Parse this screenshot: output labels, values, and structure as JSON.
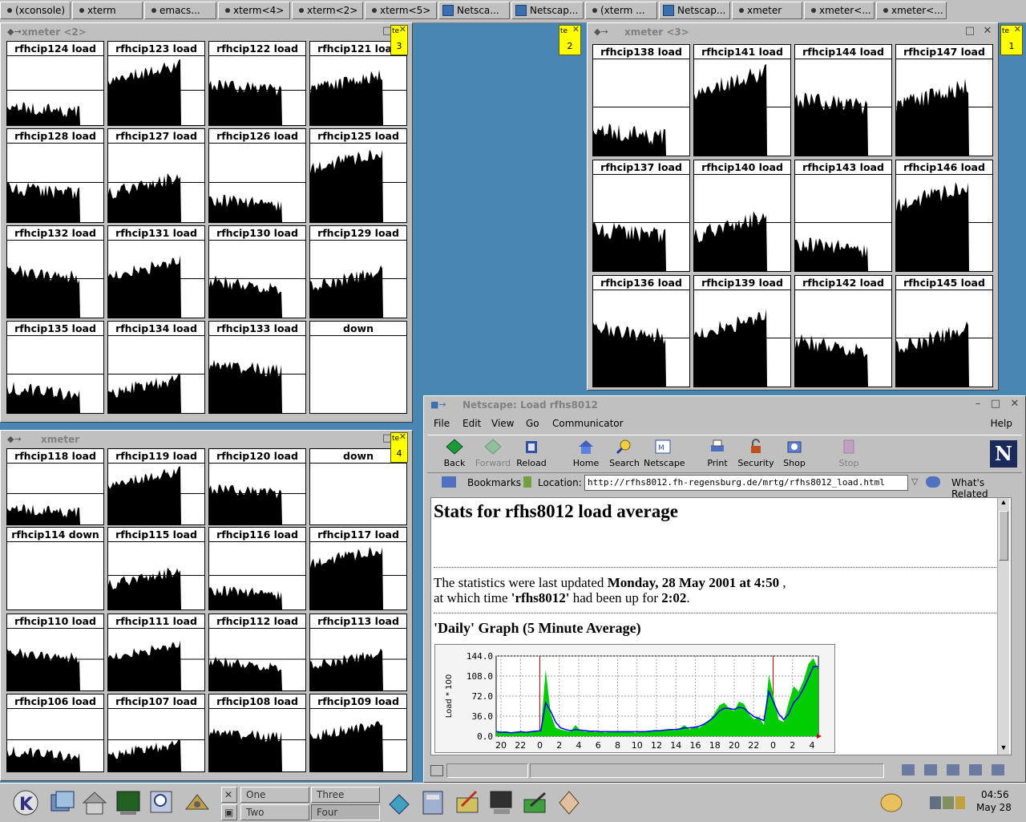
{
  "taskbar": [
    {
      "label": "(xconsole)",
      "icon": "dot-icon"
    },
    {
      "label": "xterm",
      "icon": "dot-icon"
    },
    {
      "label": "emacs...",
      "icon": "dot-icon"
    },
    {
      "label": "xterm<4>",
      "icon": "dot-icon"
    },
    {
      "label": "xterm<2>",
      "icon": "dot-icon"
    },
    {
      "label": "xterm<5>",
      "icon": "dot-icon"
    },
    {
      "label": "Netsca...",
      "icon": "netscape-icon"
    },
    {
      "label": "Netscap...",
      "icon": "netscape-icon"
    },
    {
      "label": "(xterm ...",
      "icon": "dot-icon"
    },
    {
      "label": "Netscap...",
      "icon": "netscape-icon"
    },
    {
      "label": "xmeter",
      "icon": "dot-icon"
    },
    {
      "label": "xmeter<...",
      "icon": "dot-icon"
    },
    {
      "label": "xmeter<...",
      "icon": "dot-icon"
    }
  ],
  "xmeter2": {
    "title": "xmeter <2>",
    "badge": "3",
    "cells": [
      "rfhcip124 load",
      "rfhcip123 load",
      "rfhcip122 load",
      "rfhcip121 load",
      "rfhcip128 load",
      "rfhcip127 load",
      "rfhcip126 load",
      "rfhcip125 load",
      "rfhcip132 load",
      "rfhcip131 load",
      "rfhcip130 load",
      "rfhcip129 load",
      "rfhcip135 load",
      "rfhcip134 load",
      "rfhcip133 load",
      "down"
    ]
  },
  "xmeter3": {
    "title": "xmeter <3>",
    "badge_left": "2",
    "badge_right": "1",
    "cells": [
      "rfhcip138 load",
      "rfhcip141 load",
      "rfhcip144 load",
      "rfhcip147 load",
      "rfhcip137 load",
      "rfhcip140 load",
      "rfhcip143 load",
      "rfhcip146 load",
      "rfhcip136 load",
      "rfhcip139 load",
      "rfhcip142 load",
      "rfhcip145 load"
    ]
  },
  "xmeter1": {
    "title": "xmeter",
    "badge": "4",
    "cells": [
      "rfhcip118 load",
      "rfhcip119 load",
      "rfhcip120 load",
      "down",
      "rfhcip114 down",
      "rfhcip115 load",
      "rfhcip116 load",
      "rfhcip117 load",
      "rfhcip110 load",
      "rfhcip111 load",
      "rfhcip112 load",
      "rfhcip113 load",
      "rfhcip106 load",
      "rfhcip107 load",
      "rfhcip108 load",
      "rfhcip109 load"
    ]
  },
  "badge_label": "te",
  "netscape": {
    "title": "Netscape: Load rfhs8012",
    "menu": [
      "File",
      "Edit",
      "View",
      "Go",
      "Communicator"
    ],
    "help": "Help",
    "toolbar": [
      "Back",
      "Forward",
      "Reload",
      "Home",
      "Search",
      "Netscape",
      "Print",
      "Security",
      "Shop",
      "Stop"
    ],
    "bookmarks": "Bookmarks",
    "location_label": "Location:",
    "url": "http://rfhs8012.fh-regensburg.de/mrtg/rfhs8012_load.html",
    "whats_related": "What's Related",
    "page": {
      "heading": "Stats for rfhs8012 load average",
      "updated_pre": "The statistics were last updated ",
      "updated_date": "Monday, 28 May 2001 at 4:50",
      "updated_post": " ,",
      "uptime_pre": "at which time ",
      "host": "'rfhs8012'",
      "uptime_mid": " had been up for ",
      "uptime": "2:02",
      "uptime_post": ".",
      "graph_heading": "'Daily' Graph (5 Minute Average)"
    }
  },
  "chart_data": {
    "type": "area",
    "ylabel": "Load * 100",
    "yticks": [
      "144.0",
      "108.0",
      "72.0",
      "36.0",
      "0.0"
    ],
    "ylim": [
      0,
      144
    ],
    "xticks": [
      "20",
      "22",
      "0",
      "2",
      "4",
      "6",
      "8",
      "10",
      "12",
      "14",
      "16",
      "18",
      "20",
      "22",
      "0",
      "2",
      "4"
    ],
    "series": [
      {
        "values": [
          10,
          8,
          9,
          7,
          8,
          9,
          6,
          8,
          10,
          9,
          120,
          40,
          15,
          12,
          10,
          8,
          20,
          10,
          8,
          9,
          7,
          8,
          6,
          8,
          9,
          7,
          8,
          9,
          6,
          8,
          9,
          8,
          10,
          9,
          11,
          12,
          10,
          14,
          20,
          12,
          18,
          15,
          22,
          28,
          40,
          55,
          60,
          50,
          45,
          62,
          58,
          40,
          30,
          35,
          20,
          110,
          70,
          30,
          25,
          60,
          90,
          80,
          100,
          130,
          140,
          120
        ]
      },
      {
        "values": [
          8,
          7,
          7,
          6,
          7,
          8,
          7,
          8,
          9,
          10,
          60,
          45,
          25,
          15,
          12,
          10,
          12,
          11,
          10,
          9,
          9,
          8,
          8,
          8,
          8,
          8,
          8,
          8,
          8,
          8,
          8,
          9,
          10,
          10,
          11,
          12,
          12,
          13,
          15,
          15,
          16,
          18,
          22,
          28,
          35,
          45,
          50,
          50,
          48,
          52,
          50,
          42,
          35,
          32,
          28,
          80,
          60,
          40,
          30,
          40,
          60,
          70,
          85,
          105,
          125,
          125
        ]
      }
    ]
  },
  "desktops": [
    "One",
    "Two",
    "Three",
    "Four"
  ],
  "clock": {
    "time": "04:56",
    "date": "May 28"
  }
}
